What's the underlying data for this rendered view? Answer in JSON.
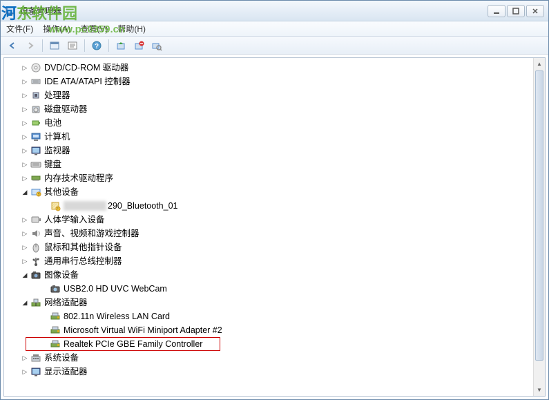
{
  "watermark": {
    "text_blue": "河",
    "text_green": "东软件园",
    "url": "www.pc0359.cn"
  },
  "window": {
    "title": "设备管理器"
  },
  "menu": {
    "file": "文件(F)",
    "action": "操作(A)",
    "view": "查看(V)",
    "help": "帮助(H)"
  },
  "tree": {
    "items": [
      {
        "label": "DVD/CD-ROM 驱动器",
        "icon": "dvd",
        "level": 1,
        "expander": "closed"
      },
      {
        "label": "IDE ATA/ATAPI 控制器",
        "icon": "ide",
        "level": 1,
        "expander": "closed"
      },
      {
        "label": "处理器",
        "icon": "cpu",
        "level": 1,
        "expander": "closed"
      },
      {
        "label": "磁盘驱动器",
        "icon": "disk",
        "level": 1,
        "expander": "closed"
      },
      {
        "label": "电池",
        "icon": "battery",
        "level": 1,
        "expander": "closed"
      },
      {
        "label": "计算机",
        "icon": "computer",
        "level": 1,
        "expander": "closed"
      },
      {
        "label": "监视器",
        "icon": "monitor",
        "level": 1,
        "expander": "closed"
      },
      {
        "label": "键盘",
        "icon": "keyboard",
        "level": 1,
        "expander": "closed"
      },
      {
        "label": "内存技术驱动程序",
        "icon": "memory",
        "level": 1,
        "expander": "closed"
      },
      {
        "label": "其他设备",
        "icon": "other",
        "level": 1,
        "expander": "open"
      },
      {
        "label": "290_Bluetooth_01",
        "icon": "unknown",
        "level": 2,
        "expander": "none",
        "blurred_prefix": true
      },
      {
        "label": "人体学输入设备",
        "icon": "hid",
        "level": 1,
        "expander": "closed"
      },
      {
        "label": "声音、视频和游戏控制器",
        "icon": "sound",
        "level": 1,
        "expander": "closed"
      },
      {
        "label": "鼠标和其他指针设备",
        "icon": "mouse",
        "level": 1,
        "expander": "closed"
      },
      {
        "label": "通用串行总线控制器",
        "icon": "usb",
        "level": 1,
        "expander": "closed"
      },
      {
        "label": "图像设备",
        "icon": "imaging",
        "level": 1,
        "expander": "open"
      },
      {
        "label": "USB2.0 HD UVC WebCam",
        "icon": "camera",
        "level": 2,
        "expander": "none"
      },
      {
        "label": "网络适配器",
        "icon": "network",
        "level": 1,
        "expander": "open"
      },
      {
        "label": "802.11n Wireless LAN Card",
        "icon": "netcard",
        "level": 2,
        "expander": "none"
      },
      {
        "label": "Microsoft Virtual WiFi Miniport Adapter #2",
        "icon": "netcard",
        "level": 2,
        "expander": "none"
      },
      {
        "label": "Realtek PCIe GBE Family Controller",
        "icon": "netcard",
        "level": 2,
        "expander": "none",
        "highlighted": true
      },
      {
        "label": "系统设备",
        "icon": "system",
        "level": 1,
        "expander": "closed"
      },
      {
        "label": "显示适配器",
        "icon": "display",
        "level": 1,
        "expander": "closed"
      }
    ]
  }
}
